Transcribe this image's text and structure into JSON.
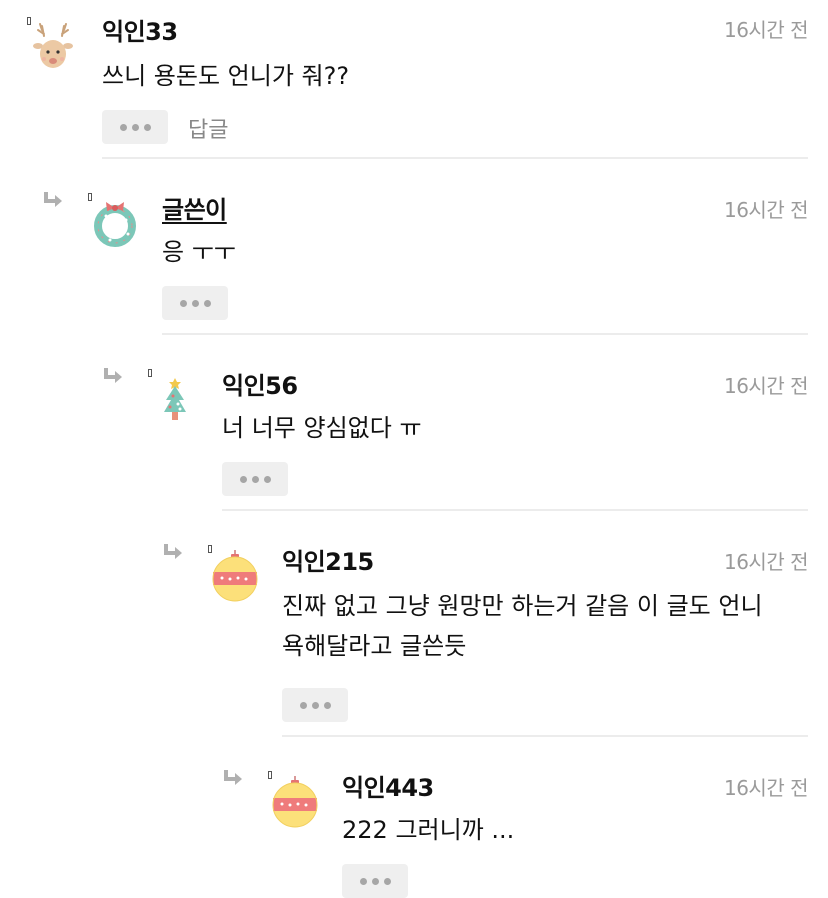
{
  "comments": [
    {
      "author": "익인33",
      "time": "16시간 전",
      "body": "쓰니 용돈도 언니가 줘??",
      "reply_label": "답글",
      "avatar": "reindeer-icon"
    },
    {
      "author": "글쓴이",
      "time": "16시간 전",
      "body": "응 ㅜㅜ",
      "avatar": "wreath-icon"
    },
    {
      "author": "익인56",
      "time": "16시간 전",
      "body": "너 너무 양심없다 ㅠ",
      "avatar": "christmas-tree-icon"
    },
    {
      "author": "익인215",
      "time": "16시간 전",
      "body": "진짜 없고 그냥 원망만 하는거 같음 이 글도 언니 욕해달라고 글쓴듯",
      "avatar": "ornament-icon"
    },
    {
      "author": "익인443",
      "time": "16시간 전",
      "body": "222 그러니까 ...",
      "avatar": "ornament-icon"
    }
  ],
  "colors": {
    "time": "#9a9a9a",
    "button_bg": "#efefef",
    "divider": "#ececec",
    "reply_arrow": "#b0b0b0"
  }
}
